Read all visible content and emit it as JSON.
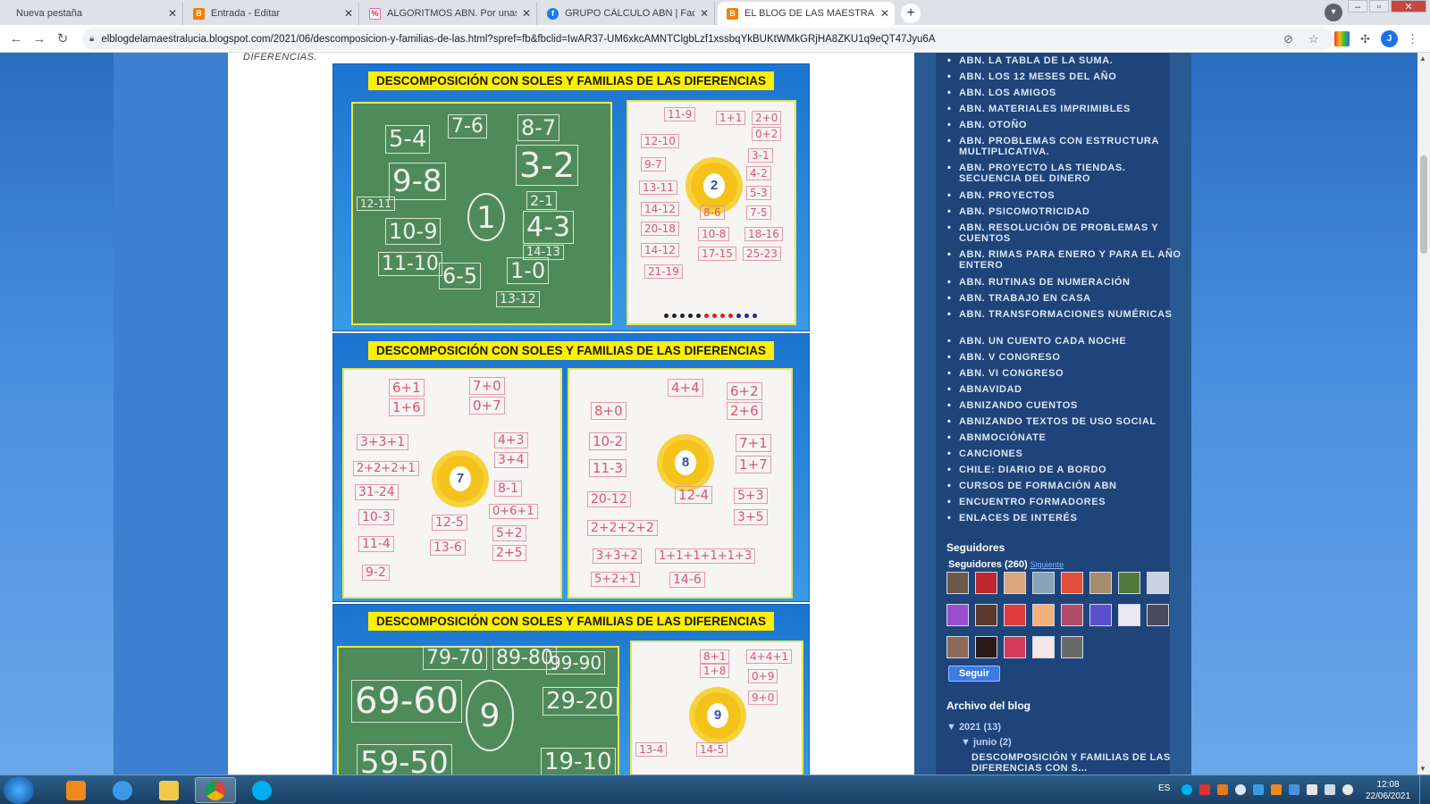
{
  "browser": {
    "tabs": [
      {
        "title": "Nueva pestaña",
        "icon": "none",
        "active": false
      },
      {
        "title": "Entrada - Editar",
        "icon": "blogger-icon",
        "active": false
      },
      {
        "title": "ALGORITMOS ABN. Por unas ma",
        "icon": "abn-icon",
        "active": false
      },
      {
        "title": "GRUPO CÁLCULO ABN | Facebo",
        "icon": "facebook-icon",
        "active": false
      },
      {
        "title": "EL BLOG DE LAS MAESTRAS LUC",
        "icon": "blogger-icon",
        "active": true
      }
    ],
    "close_glyph": "✕",
    "new_tab_glyph": "+",
    "url": "elblogdelamaestralucia.blogspot.com/2021/06/descomposicion-y-familias-de-las.html?spref=fb&fbclid=IwAR37-UM6xkcAMNTClgbLzf1xssbqYkBUKtWMkGRjHA8ZKU1q9eQT47Jyu6A",
    "profile_initial": "J",
    "window_controls": [
      "–",
      "▫",
      "✕"
    ]
  },
  "post": {
    "heading_fragment": "DIFERENCIAS.",
    "images": [
      {
        "title": "DESCOMPOSICIÓN CON SOLES Y FAMILIAS DE LAS DIFERENCIAS",
        "left_board": {
          "center": "1",
          "cells": [
            "5-4",
            "7-6",
            "8-7",
            "9-8",
            "3-2",
            "2-1",
            "12-11",
            "10-9",
            "4-3",
            "14-13",
            "11-10",
            "6-5",
            "1-0",
            "13-12"
          ]
        },
        "right_board": {
          "center": "2",
          "cells": [
            "11-9",
            "1+1",
            "2+0",
            "0+2",
            "12-10",
            "3-1",
            "9-7",
            "4-2",
            "13-11",
            "5-3",
            "14-12",
            "8-6",
            "7-5",
            "20-18",
            "10-8",
            "18-16",
            "14-12",
            "17-15",
            "25-23",
            "21-19"
          ]
        }
      },
      {
        "title": "DESCOMPOSICIÓN CON SOLES Y FAMILIAS DE LAS DIFERENCIAS",
        "left_board": {
          "center": "7",
          "cells": [
            "6+1",
            "7+0",
            "1+6",
            "0+7",
            "3+3+1",
            "4+3",
            "3+4",
            "2+2+2+1",
            "8-1",
            "31-24",
            "0+6+1",
            "10-3",
            "12-5",
            "5+2",
            "11-4",
            "13-6",
            "2+5",
            "9-2"
          ]
        },
        "right_board": {
          "center": "8",
          "cells": [
            "4+4",
            "6+2",
            "8+0",
            "2+6",
            "10-2",
            "7+1",
            "11-3",
            "1+7",
            "20-12",
            "12-4",
            "5+3",
            "2+2+2+2",
            "3+5",
            "3+3+2",
            "1+1+1+1+1+3",
            "5+2+1",
            "14-6"
          ]
        }
      },
      {
        "title": "DESCOMPOSICIÓN CON SOLES Y FAMILIAS DE LAS DIFERENCIAS",
        "left_board": {
          "center": "9",
          "cells": [
            "79-70",
            "89-80",
            "99-90",
            "69-60",
            "29-20",
            "59-50",
            "19-10"
          ]
        },
        "right_board": {
          "center": "9",
          "cells": [
            "8+1",
            "4+4+1",
            "1+8",
            "0+9",
            "9+0",
            "13-4",
            "14-5"
          ]
        }
      }
    ]
  },
  "sidebar": {
    "labels": [
      "ABN. LA TABLA DE LA SUMA.",
      "ABN. LOS 12 MESES DEL AÑO",
      "ABN. LOS AMIGOS",
      "ABN. MATERIALES IMPRIMIBLES",
      "ABN. OTOÑO",
      "ABN. PROBLEMAS CON ESTRUCTURA MULTIPLICATIVA.",
      "ABN. PROYECTO LAS TIENDAS. SECUENCIA DEL DINERO",
      "ABN. PROYECTOS",
      "ABN. PSICOMOTRICIDAD",
      "ABN. RESOLUCIÓN DE PROBLEMAS Y CUENTOS",
      "ABN. RIMAS PARA ENERO Y PARA EL AÑO ENTERO",
      "ABN. RUTINAS DE NUMERACIÓN",
      "ABN. TRABAJO EN CASA",
      "ABN. TRANSFORMACIONES NUMÉRICAS",
      "ABN. UN CUENTO CADA NOCHE",
      "ABN. V CONGRESO",
      "ABN. VI CONGRESO",
      "ABNAVIDAD",
      "ABNIZANDO CUENTOS",
      "ABNIZANDO TEXTOS DE USO SOCIAL",
      "ABNMOCIÓNATE",
      "CANCIONES",
      "CHILE: DIARIO DE A BORDO",
      "CURSOS DE FORMACIÓN ABN",
      "ENCUENTRO FORMADORES",
      "ENLACES DE INTERÉS"
    ],
    "followers": {
      "heading": "Seguidores",
      "count_label": "Seguidores (260)",
      "next_link": "Siguiente",
      "follow_button": "Seguir",
      "avatar_colors": [
        "#6b5a4a",
        "#c0262e",
        "#d9a77a",
        "#8aa3b8",
        "#e44d3a",
        "#a48c6c",
        "#4f7a3c",
        "#c8d2e0",
        "#9b4fcf",
        "#5a3a2a",
        "#e23b3b",
        "#f2b07a",
        "#b24a6a",
        "#5a4fcf",
        "#e8e8ee",
        "#4a4a5a",
        "#8c6a5a",
        "#2a1a1a",
        "#d63a5a",
        "#f2e6e6",
        "#6a6a6a"
      ]
    },
    "archive": {
      "heading": "Archivo del blog",
      "year": "▼ 2021 (13)",
      "month": "▼ junio (2)",
      "post": "DESCOMPOSICIÓN Y FAMILIAS DE LAS DIFERENCIAS CON S..."
    }
  },
  "taskbar": {
    "language": "ES",
    "time": "12:08",
    "date": "22/06/2021"
  }
}
